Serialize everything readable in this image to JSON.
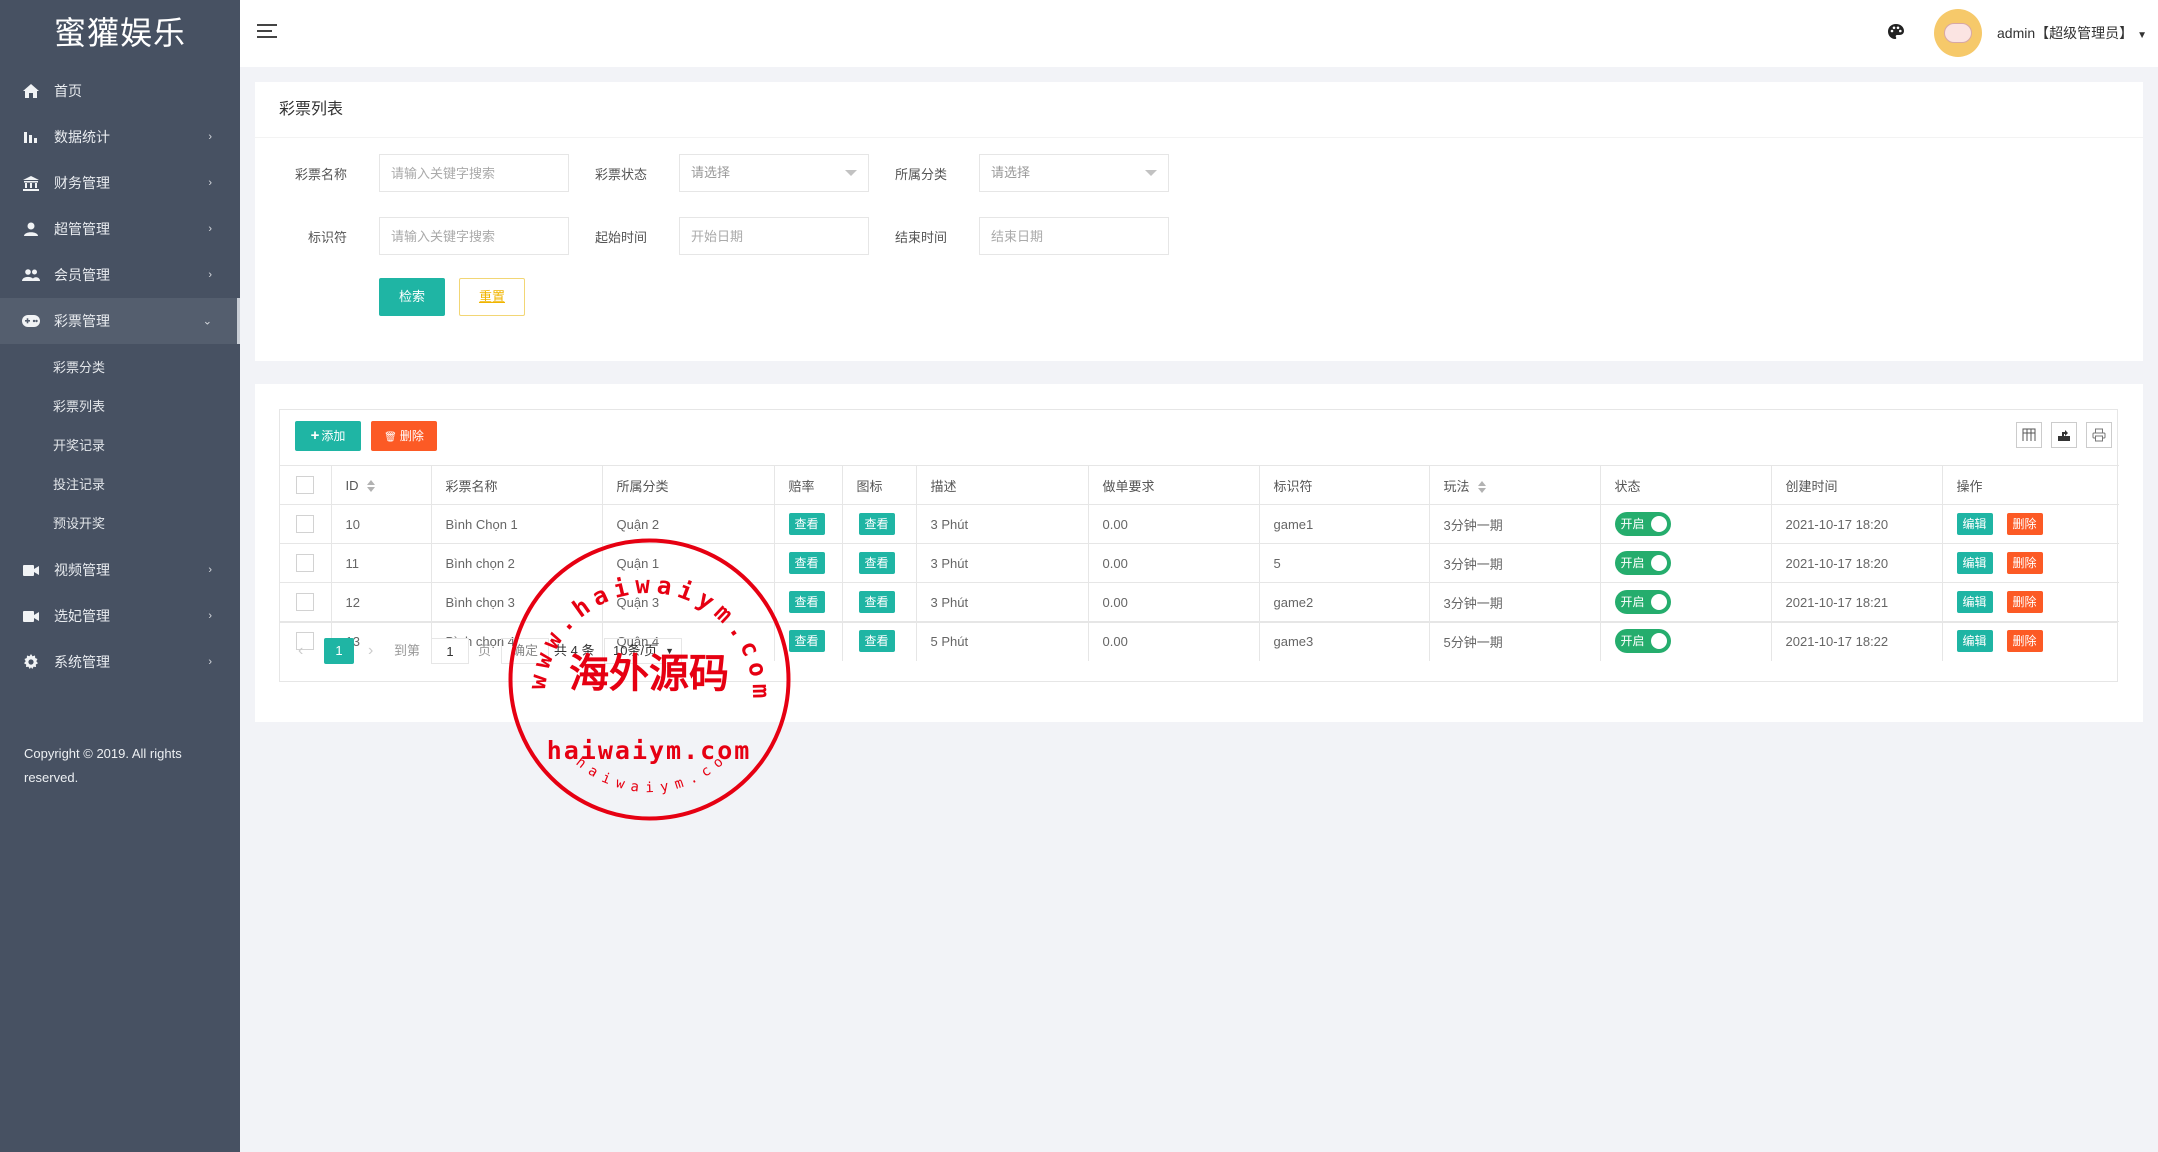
{
  "app": {
    "logo": "蜜獾娱乐",
    "copyright": "Copyright © 2019. All rights reserved."
  },
  "sidebar": {
    "items": [
      {
        "label": "首页",
        "icon": "home-icon",
        "has_children": false
      },
      {
        "label": "数据统计",
        "icon": "bar-chart-icon",
        "has_children": true
      },
      {
        "label": "财务管理",
        "icon": "bank-icon",
        "has_children": true
      },
      {
        "label": "超管管理",
        "icon": "user-icon",
        "has_children": true
      },
      {
        "label": "会员管理",
        "icon": "users-icon",
        "has_children": true
      },
      {
        "label": "彩票管理",
        "icon": "gamepad-icon",
        "has_children": true,
        "expanded": true,
        "children": [
          "彩票分类",
          "彩票列表",
          "开奖记录",
          "投注记录",
          "预设开奖"
        ]
      },
      {
        "label": "视频管理",
        "icon": "video-icon",
        "has_children": true
      },
      {
        "label": "选妃管理",
        "icon": "video-icon",
        "has_children": true
      },
      {
        "label": "系统管理",
        "icon": "gear-icon",
        "has_children": true
      }
    ]
  },
  "header": {
    "user": "admin【超级管理员】",
    "theme_icon": "palette-icon",
    "menu_icon": "hamburger-icon"
  },
  "search_card": {
    "title": "彩票列表",
    "fields": {
      "name_label": "彩票名称",
      "name_placeholder": "请输入关键字搜索",
      "status_label": "彩票状态",
      "status_value": "请选择",
      "category_label": "所属分类",
      "category_value": "请选择",
      "identifier_label": "标识符",
      "identifier_placeholder": "请输入关键字搜索",
      "start_label": "起始时间",
      "start_placeholder": "开始日期",
      "end_label": "结束时间",
      "end_placeholder": "结束日期"
    },
    "search_button": "检索",
    "reset_button": "重置"
  },
  "table_card": {
    "add_button": "添加",
    "delete_button": "删除",
    "tool_icons": [
      "columns-icon",
      "export-icon",
      "print-icon"
    ],
    "columns": [
      "ID",
      "彩票名称",
      "所属分类",
      "赔率",
      "图标",
      "描述",
      "做单要求",
      "标识符",
      "玩法",
      "状态",
      "创建时间",
      "操作"
    ],
    "view_label": "查看",
    "edit_label": "编辑",
    "row_delete_label": "删除",
    "rows": [
      {
        "id": "10",
        "name": "Bình Chọn 1",
        "category": "Quận 2",
        "desc": "3 Phút",
        "order_req": "0.00",
        "identifier": "game1",
        "play": "3分钟一期",
        "status": "开启",
        "created": "2021-10-17 18:20"
      },
      {
        "id": "11",
        "name": "Bình chọn 2",
        "category": "Quận 1",
        "desc": "3 Phút",
        "order_req": "0.00",
        "identifier": "5",
        "play": "3分钟一期",
        "status": "开启",
        "created": "2021-10-17 18:20"
      },
      {
        "id": "12",
        "name": "Bình chọn 3",
        "category": "Quận 3",
        "desc": "3 Phút",
        "order_req": "0.00",
        "identifier": "game2",
        "play": "3分钟一期",
        "status": "开启",
        "created": "2021-10-17 18:21"
      },
      {
        "id": "13",
        "name": "Bình chọn 4",
        "category": "Quận 4",
        "desc": "5 Phút",
        "order_req": "0.00",
        "identifier": "game3",
        "play": "5分钟一期",
        "status": "开启",
        "created": "2021-10-17 18:22"
      }
    ],
    "pagination": {
      "current": "1",
      "goto_label": "到第",
      "goto_value": "1",
      "page_label": "页",
      "confirm": "确定",
      "total": "共 4 条",
      "page_size": "10条/页"
    }
  },
  "watermark": {
    "outer_text": "www.haiwaiym.com",
    "center_text": "海外源码",
    "domain_text": "haiwaiym.com",
    "bottom_text": "haiwaiym.com"
  },
  "colors": {
    "sidebar_bg": "#475162",
    "primary": "#1fb5a4",
    "danger": "#fc5a25",
    "switch_on": "#25ad6d",
    "reset_border": "#f2d675",
    "watermark_red": "#e60012"
  }
}
